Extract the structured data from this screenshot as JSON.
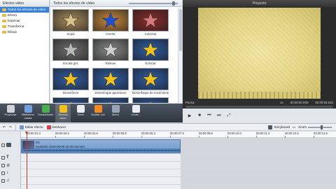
{
  "categories": {
    "title": "Efectos video",
    "items": [
      {
        "label": "Todos los efectos de vídeo",
        "selected": true
      },
      {
        "label": "Efecto",
        "selected": false
      },
      {
        "label": "Especial",
        "selected": false
      },
      {
        "label": "Transforme",
        "selected": false
      },
      {
        "label": "Dibujo",
        "selected": false
      }
    ]
  },
  "gallery": {
    "title": "Todos los efectos de vídeo",
    "items": [
      {
        "label": "Sepia",
        "bg": "#a88c5c",
        "star": "#d9c28c"
      },
      {
        "label": "Invertir",
        "bg": "#c98a3a",
        "star": "#1f4fd6"
      },
      {
        "label": "Colorear",
        "bg": "#8c2b2b",
        "star": "#d97a7a"
      },
      {
        "label": "Escala gris",
        "bg": "#6f6f6f",
        "star": "#b9b9b9"
      },
      {
        "label": "Relieve",
        "bg": "#8a8a8a",
        "star": "#cfcfcf"
      },
      {
        "label": "Enfocar",
        "bg": "#2e5ea8",
        "star": "#f2c21a"
      },
      {
        "label": "Desenfocar",
        "bg": "#2e5ea8",
        "star": "#f2c21a"
      },
      {
        "label": "Desenfoque gaussiano",
        "bg": "#2e5ea8",
        "star": "#f2c21a"
      },
      {
        "label": "Desenfoque de movimiento",
        "bg": "#2e5ea8",
        "star": "#f2c21a"
      },
      {
        "label": "",
        "bg": "#2e5ea8",
        "star": "#f2c21a"
      },
      {
        "label": "",
        "bg": "#2e5ea8",
        "star": "#f2c21a"
      },
      {
        "label": "",
        "bg": "#2e5ea8",
        "star": "#f2c21a"
      }
    ]
  },
  "preview": {
    "title": "Proyecto",
    "state": "Pausa",
    "time_left": "00:00:00.000",
    "time_right": "00:00:08.533",
    "zoom": "1x",
    "time_mid": "00:00:00.000"
  },
  "toolbar": {
    "tools": [
      {
        "label": "Proyectar",
        "icon": "projector-icon",
        "color": "#d0d4da",
        "active": false
      },
      {
        "label": "Biblioteca media",
        "icon": "media-library-icon",
        "color": "#6fa0e0",
        "active": false
      },
      {
        "label": "Transiciones",
        "icon": "transitions-icon",
        "color": "#4caf50",
        "active": false
      },
      {
        "label": "Efectos video",
        "icon": "video-effects-icon",
        "color": "#f2c21a",
        "active": true
      },
      {
        "label": "Texto",
        "icon": "text-icon",
        "color": "#e9edf2",
        "active": false
      },
      {
        "label": "Grabar voz",
        "icon": "record-voice-icon",
        "color": "#f08a24",
        "active": false
      },
      {
        "label": "Menú",
        "icon": "menu-icon",
        "color": "#9aa4b2",
        "active": false
      },
      {
        "label": "Crear...",
        "icon": "create-icon",
        "color": "#e9edf2",
        "active": false
      }
    ]
  },
  "timeline_toolbar": {
    "edit_effect": "Editar efecto",
    "delete": "Deshacer",
    "storyboard": "Storyboard",
    "zoom": "Zoom"
  },
  "ruler": {
    "ticks": [
      "00:00:01.3",
      "00:00:02.5",
      "00:00:03.8",
      "00:00:05.0",
      "00:00:06.3",
      "00:00:07.5",
      "00:00:08.8",
      "00:00:10.0",
      "00:00:11.3",
      "00:00:12.5",
      "00:00:13.8"
    ]
  },
  "clip": {
    "name": "lovebirds 2016-06-08 18-25-19.mp4",
    "effect": "Efc"
  }
}
